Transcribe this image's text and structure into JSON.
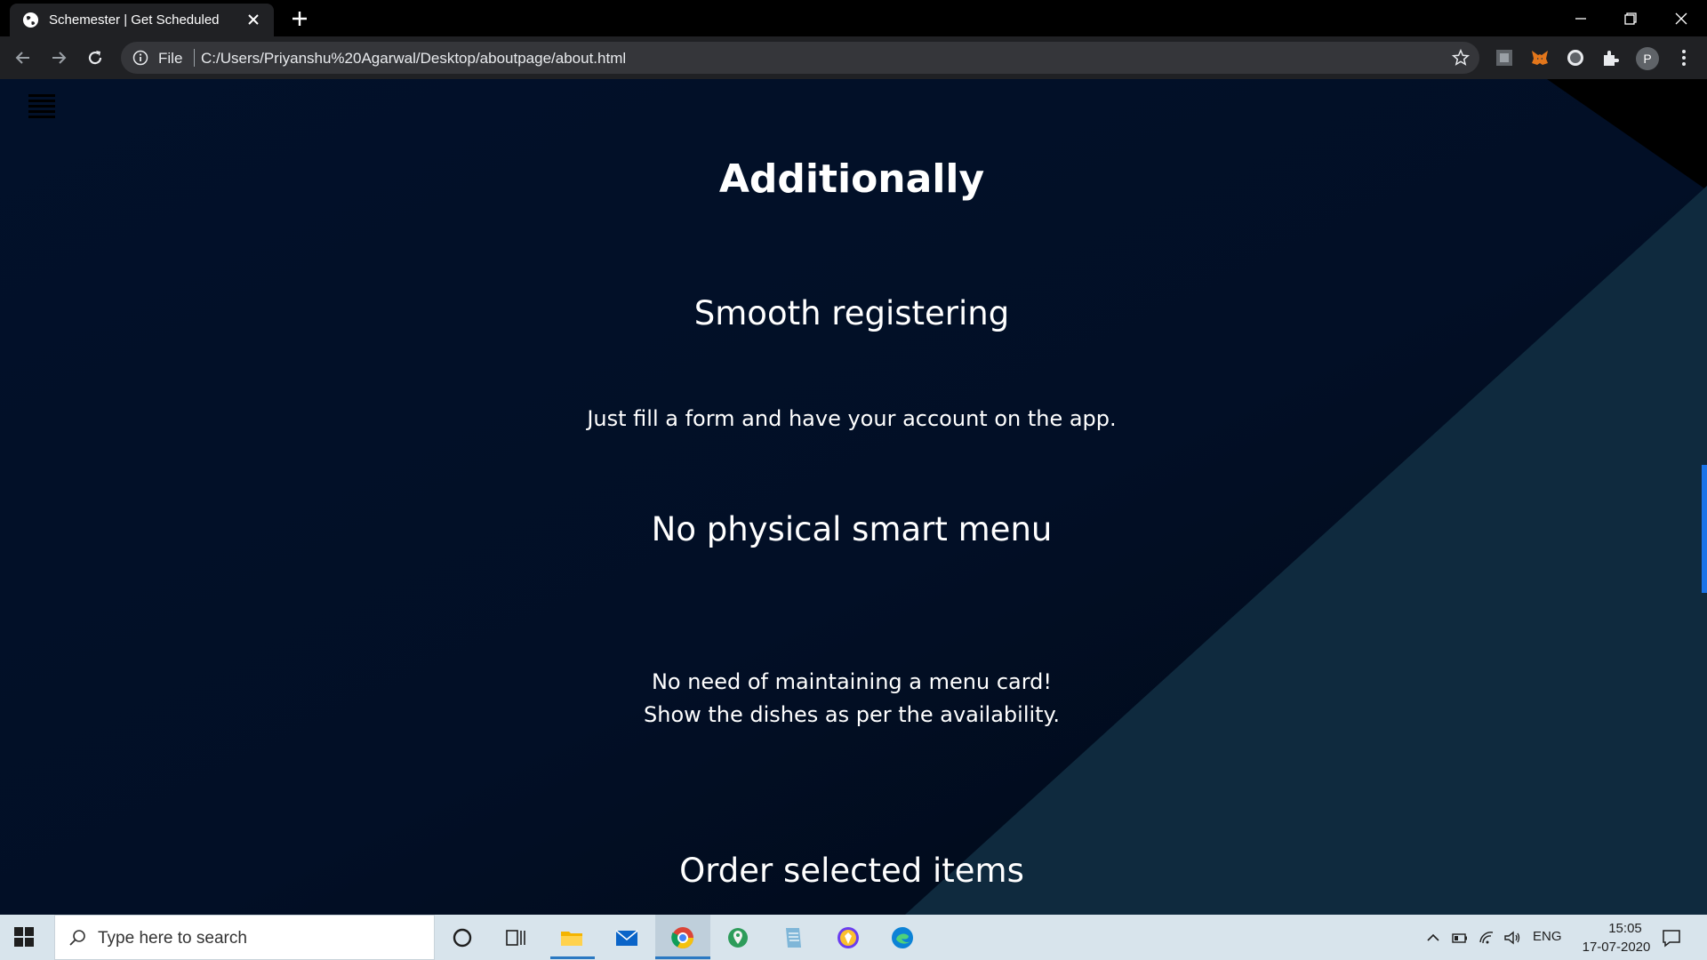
{
  "browser": {
    "tab_title": "Schemester | Get Scheduled",
    "omnibox_scheme": "File",
    "omnibox_url": "C:/Users/Priyanshu%20Agarwal/Desktop/aboutpage/about.html",
    "profile_initial": "P"
  },
  "page": {
    "heading": "Additionally",
    "features": [
      {
        "title": "Smooth registering",
        "lines": [
          "Just fill a form and have your account on the app."
        ]
      },
      {
        "title": "No physical smart menu",
        "lines": [
          "No need of maintaining a menu card!",
          "Show the dishes as per the availability."
        ]
      },
      {
        "title": "Order selected items",
        "lines": []
      }
    ],
    "colors": {
      "background": "#02112a",
      "accent_panel": "#0f2a3e",
      "text": "#ffffff",
      "scrollbar": "#1a73e8"
    }
  },
  "taskbar": {
    "search_placeholder": "Type here to search",
    "language": "ENG",
    "time": "15:05",
    "date": "17-07-2020",
    "pinned": [
      "cortana-icon",
      "task-view-icon",
      "file-explorer-icon",
      "mail-icon",
      "chrome-icon",
      "maps-icon",
      "notepad-icon",
      "brave-icon",
      "edge-icon"
    ]
  }
}
